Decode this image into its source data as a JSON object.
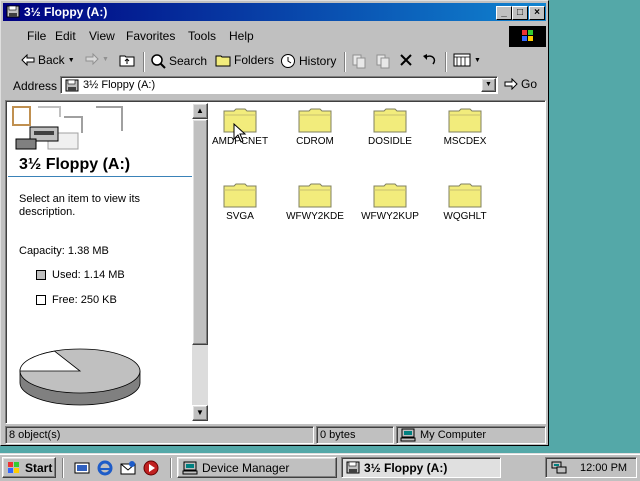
{
  "window": {
    "title": "3½ Floppy (A:)"
  },
  "menu": [
    "File",
    "Edit",
    "View",
    "Favorites",
    "Tools",
    "Help"
  ],
  "toolbar": {
    "back": "Back",
    "search": "Search",
    "folders": "Folders",
    "history": "History"
  },
  "address": {
    "label": "Address",
    "value": "3½ Floppy (A:)",
    "go": "Go"
  },
  "left_pane": {
    "title": "3½ Floppy (A:)",
    "description": "Select an item to view its description.",
    "capacity": "Capacity: 1.38 MB",
    "used": "Used: 1.14 MB",
    "free": "Free: 250 KB",
    "used_fraction": 0.82
  },
  "files": [
    {
      "name": "AMDPCNET"
    },
    {
      "name": "CDROM"
    },
    {
      "name": "DOSIDLE"
    },
    {
      "name": "MSCDEX"
    },
    {
      "name": "SVGA"
    },
    {
      "name": "WFWY2KDE"
    },
    {
      "name": "WFWY2KUP"
    },
    {
      "name": "WQGHLT"
    }
  ],
  "status": {
    "objects": "8 object(s)",
    "size": "0 bytes",
    "zone": "My Computer"
  },
  "taskbar": {
    "start": "Start",
    "tasks": [
      "Device Manager",
      "3½ Floppy (A:)"
    ],
    "clock": "12:00 PM"
  },
  "colors": {
    "desktop": "#54a8a8",
    "title_start": "#000080",
    "title_end": "#1084d0",
    "folder": "#f2ec7c"
  }
}
